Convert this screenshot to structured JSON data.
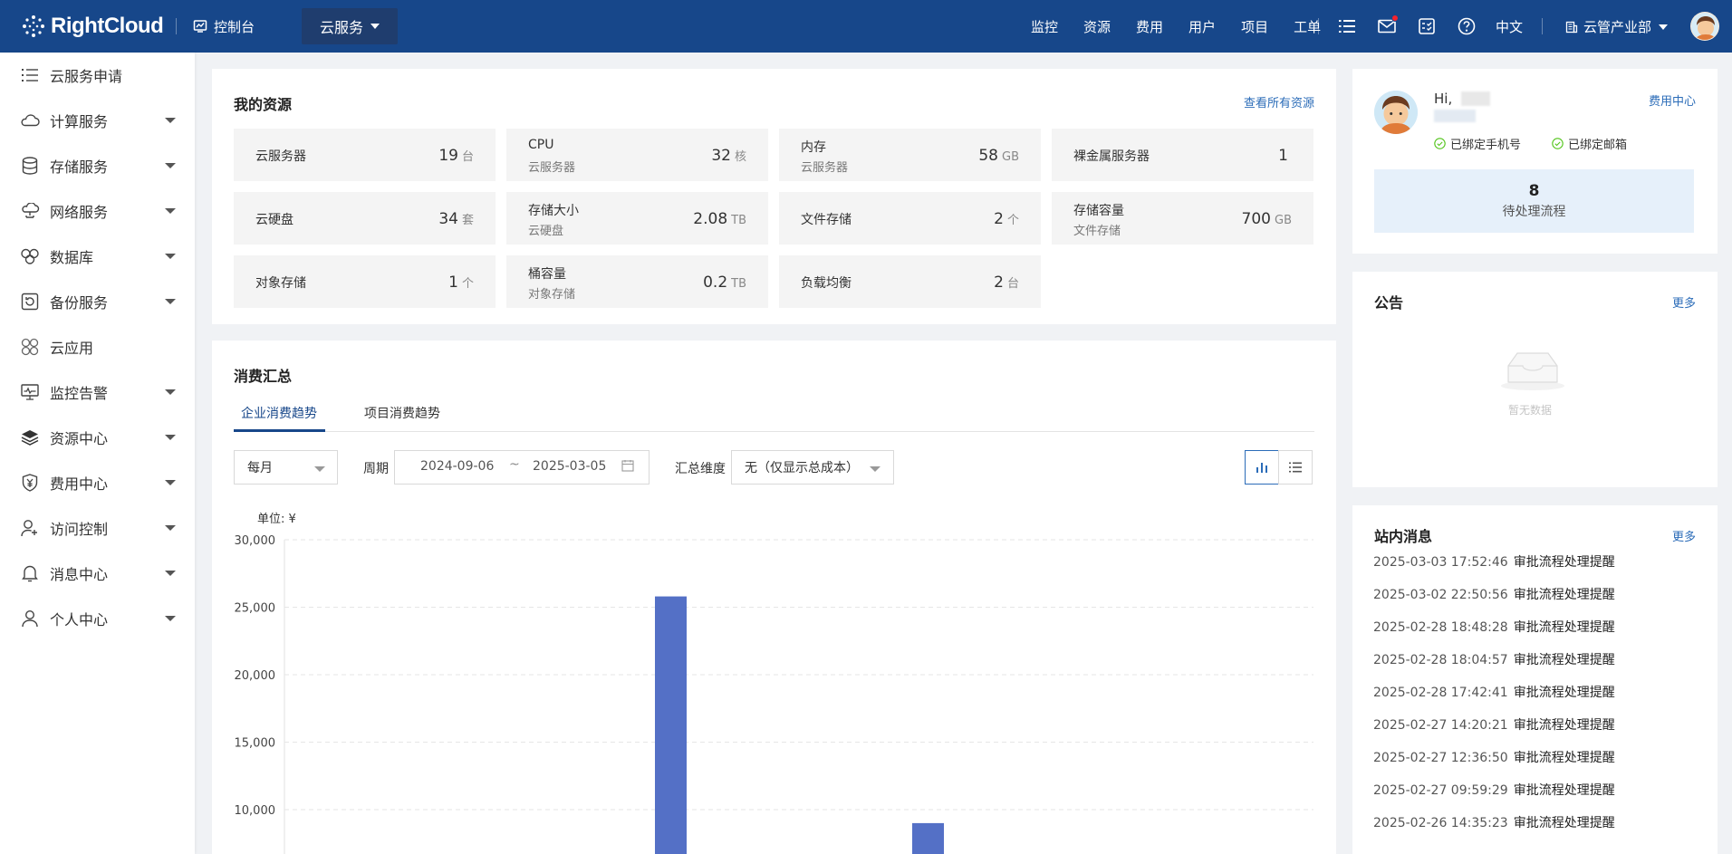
{
  "topbar": {
    "brand": "RightCloud",
    "console": "控制台",
    "cloud_service": "云服务",
    "nav": [
      "监控",
      "资源",
      "费用",
      "用户",
      "项目",
      "工单"
    ],
    "language": "中文",
    "org": "云管产业部"
  },
  "sidebar": {
    "items": [
      {
        "label": "云服务申请",
        "icon": "list-icon",
        "has_caret": false
      },
      {
        "label": "计算服务",
        "icon": "cloud-icon",
        "has_caret": true
      },
      {
        "label": "存储服务",
        "icon": "database-icon",
        "has_caret": true
      },
      {
        "label": "网络服务",
        "icon": "network-icon",
        "has_caret": true
      },
      {
        "label": "数据库",
        "icon": "db-cluster-icon",
        "has_caret": true
      },
      {
        "label": "备份服务",
        "icon": "backup-icon",
        "has_caret": true
      },
      {
        "label": "云应用",
        "icon": "apps-icon",
        "has_caret": false
      },
      {
        "label": "监控告警",
        "icon": "monitor-icon",
        "has_caret": true
      },
      {
        "label": "资源中心",
        "icon": "layers-icon",
        "has_caret": true
      },
      {
        "label": "费用中心",
        "icon": "yuan-shield-icon",
        "has_caret": true
      },
      {
        "label": "访问控制",
        "icon": "user-plus-icon",
        "has_caret": true
      },
      {
        "label": "消息中心",
        "icon": "bell-icon",
        "has_caret": true
      },
      {
        "label": "个人中心",
        "icon": "user-icon",
        "has_caret": true
      }
    ]
  },
  "resources": {
    "title": "我的资源",
    "view_all": "查看所有资源",
    "cards": [
      {
        "label": "云服务器",
        "sub": "",
        "value": "19",
        "unit": "台"
      },
      {
        "label": "CPU",
        "sub": "云服务器",
        "value": "32",
        "unit": "核"
      },
      {
        "label": "内存",
        "sub": "云服务器",
        "value": "58",
        "unit": "GB"
      },
      {
        "label": "裸金属服务器",
        "sub": "",
        "value": "1",
        "unit": ""
      },
      {
        "label": "云硬盘",
        "sub": "",
        "value": "34",
        "unit": "套"
      },
      {
        "label": "存储大小",
        "sub": "云硬盘",
        "value": "2.08",
        "unit": "TB"
      },
      {
        "label": "文件存储",
        "sub": "",
        "value": "2",
        "unit": "个"
      },
      {
        "label": "存储容量",
        "sub": "文件存储",
        "value": "700",
        "unit": "GB"
      },
      {
        "label": "对象存储",
        "sub": "",
        "value": "1",
        "unit": "个"
      },
      {
        "label": "桶容量",
        "sub": "对象存储",
        "value": "0.2",
        "unit": "TB"
      },
      {
        "label": "负载均衡",
        "sub": "",
        "value": "2",
        "unit": "台"
      }
    ]
  },
  "consumption": {
    "title": "消费汇总",
    "tabs": [
      "企业消费趋势",
      "项目消费趋势"
    ],
    "period_select": "每月",
    "period_label": "周期",
    "date_start": "2024-09-06",
    "date_sep": "~",
    "date_end": "2025-03-05",
    "dimension_label": "汇总维度",
    "dimension_select": "无（仅显示总成本）",
    "unit_label": "单位: ¥"
  },
  "chart_data": {
    "type": "bar",
    "ylim": [
      10000,
      30000
    ],
    "yticks": [
      "30,000",
      "25,000",
      "20,000",
      "15,000",
      "10,000"
    ],
    "values": [
      25800,
      9000
    ],
    "grid": true,
    "color": "#5470c6"
  },
  "profile": {
    "greeting": "Hi,",
    "fee_center": "费用中心",
    "phone_bound": "已绑定手机号",
    "email_bound": "已绑定邮箱",
    "pending_count": "8",
    "pending_label": "待处理流程"
  },
  "notice": {
    "title": "公告",
    "more": "更多",
    "empty": "暂无数据"
  },
  "messages": {
    "title": "站内消息",
    "more": "更多",
    "items": [
      {
        "time": "2025-03-03 17:52:46",
        "text": "审批流程处理提醒"
      },
      {
        "time": "2025-03-02 22:50:56",
        "text": "审批流程处理提醒"
      },
      {
        "time": "2025-02-28 18:48:28",
        "text": "审批流程处理提醒"
      },
      {
        "time": "2025-02-28 18:04:57",
        "text": "审批流程处理提醒"
      },
      {
        "time": "2025-02-28 17:42:41",
        "text": "审批流程处理提醒"
      },
      {
        "time": "2025-02-27 14:20:21",
        "text": "审批流程处理提醒"
      },
      {
        "time": "2025-02-27 12:36:50",
        "text": "审批流程处理提醒"
      },
      {
        "time": "2025-02-27 09:59:29",
        "text": "审批流程处理提醒"
      },
      {
        "time": "2025-02-26 14:35:23",
        "text": "审批流程处理提醒"
      }
    ]
  }
}
